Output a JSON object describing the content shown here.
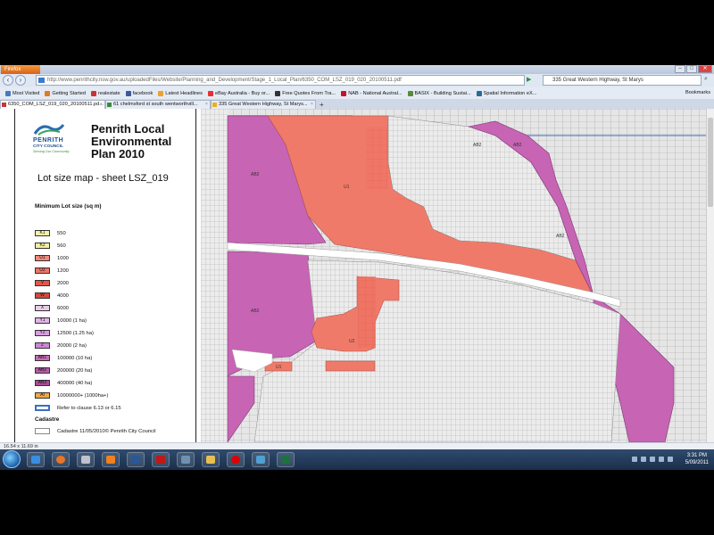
{
  "browser": {
    "app_button": "Firefox",
    "address": "http://www.penrithcity.nsw.gov.au/uploadedFiles/Website/Planning_and_Development/Stage_1_Local_Plan/6350_COM_LSZ_019_020_20100511.pdf",
    "search_text": "335 Great Western Highway, St Marys"
  },
  "bookmarks": [
    {
      "label": "Most Visited",
      "color": "#4a78c0"
    },
    {
      "label": "Getting Started",
      "color": "#e07b20"
    },
    {
      "label": "realestate",
      "color": "#d03030"
    },
    {
      "label": "facebook",
      "color": "#3b5998"
    },
    {
      "label": "Latest Headlines",
      "color": "#f0a030"
    },
    {
      "label": "eBay Australia - Buy or...",
      "color": "#e53238"
    },
    {
      "label": "Free Quotes From Tra...",
      "color": "#333333"
    },
    {
      "label": "NAB - National Austral...",
      "color": "#c8102e"
    },
    {
      "label": "BASIX - Building Sustai...",
      "color": "#5a8a3a"
    },
    {
      "label": "Spatial Information eX...",
      "color": "#2a6a9a"
    }
  ],
  "bookmarks_right": "Bookmarks",
  "tabs": [
    {
      "label": "6350_COM_LSZ_019_020_20100511.pd..."
    },
    {
      "label": "61 chelmsford st south wentworthvill..."
    },
    {
      "label": "335 Great Western Highway, St Marys..."
    }
  ],
  "legend": {
    "org_name": "PENRITH",
    "org_name2": "CITY COUNCIL",
    "tagline": "Serving Our Community",
    "title_line1": "Penrith Local",
    "title_line2": "Environmental",
    "title_line3": "Plan 2010",
    "sheet": "Lot size map - sheet LSZ_019",
    "heading": "Minimum Lot size (sq m)",
    "rows": [
      {
        "code": "K1",
        "label": "550",
        "color": "#f6f1a8"
      },
      {
        "code": "K2",
        "label": "560",
        "color": "#f4eea0"
      },
      {
        "code": "U1",
        "label": "1000",
        "color": "#f08a7a"
      },
      {
        "code": "U2",
        "label": "1200",
        "color": "#ec7464"
      },
      {
        "code": "V",
        "label": "2000",
        "color": "#e5554a"
      },
      {
        "code": "W",
        "label": "4000",
        "color": "#d9463c"
      },
      {
        "code": "X",
        "label": "6000",
        "color": "#e8cde8"
      },
      {
        "code": "Y1",
        "label": "10000 (1 ha)",
        "color": "#e0b4e6"
      },
      {
        "code": "Y2",
        "label": "12500 (1.25 ha)",
        "color": "#d89ee0"
      },
      {
        "code": "Z",
        "label": "20000 (2 ha)",
        "color": "#cc86d6"
      },
      {
        "code": "AB1",
        "label": "100000 (10 ha)",
        "color": "#c96cb8"
      },
      {
        "code": "AB2",
        "label": "200000 (20 ha)",
        "color": "#b85aa8"
      },
      {
        "code": "AB3",
        "label": "400000 (40 ha)",
        "color": "#a84c98"
      },
      {
        "code": "AI",
        "label": "10000000+ (1000ha+)",
        "color": "#f2a640"
      }
    ],
    "clause_label": "Refer to clause 6.13 or 6.15",
    "cadastre_heading": "Cadastre",
    "cadastre_label": "Cadastre 11/05/2010© Penrith City Council"
  },
  "map_labels": {
    "u1_a": "U1",
    "u1_b": "U1",
    "u2": "U2",
    "ab2_a": "AB2",
    "ab2_b": "AB2",
    "ab2_c": "AB2",
    "ab2_d": "AB2",
    "ab2_e": "AB2"
  },
  "status": {
    "size": "16.54 x 11.69 in"
  },
  "taskbar": {
    "time": "3:31 PM",
    "date": "5/09/2011",
    "apps": [
      {
        "name": "internet-explorer",
        "color": "#3a8ee0"
      },
      {
        "name": "firefox",
        "color": "#e8752a"
      },
      {
        "name": "app-3",
        "color": "#c0c0d0"
      },
      {
        "name": "vlc",
        "color": "#f08020"
      },
      {
        "name": "word",
        "color": "#2b5797"
      },
      {
        "name": "acrobat",
        "color": "#c01818"
      },
      {
        "name": "app-7",
        "color": "#7090b0"
      },
      {
        "name": "explorer",
        "color": "#e8c050"
      },
      {
        "name": "vodafone",
        "color": "#e00000"
      },
      {
        "name": "app-10",
        "color": "#50a0d0"
      },
      {
        "name": "excel",
        "color": "#1d7040"
      }
    ]
  }
}
